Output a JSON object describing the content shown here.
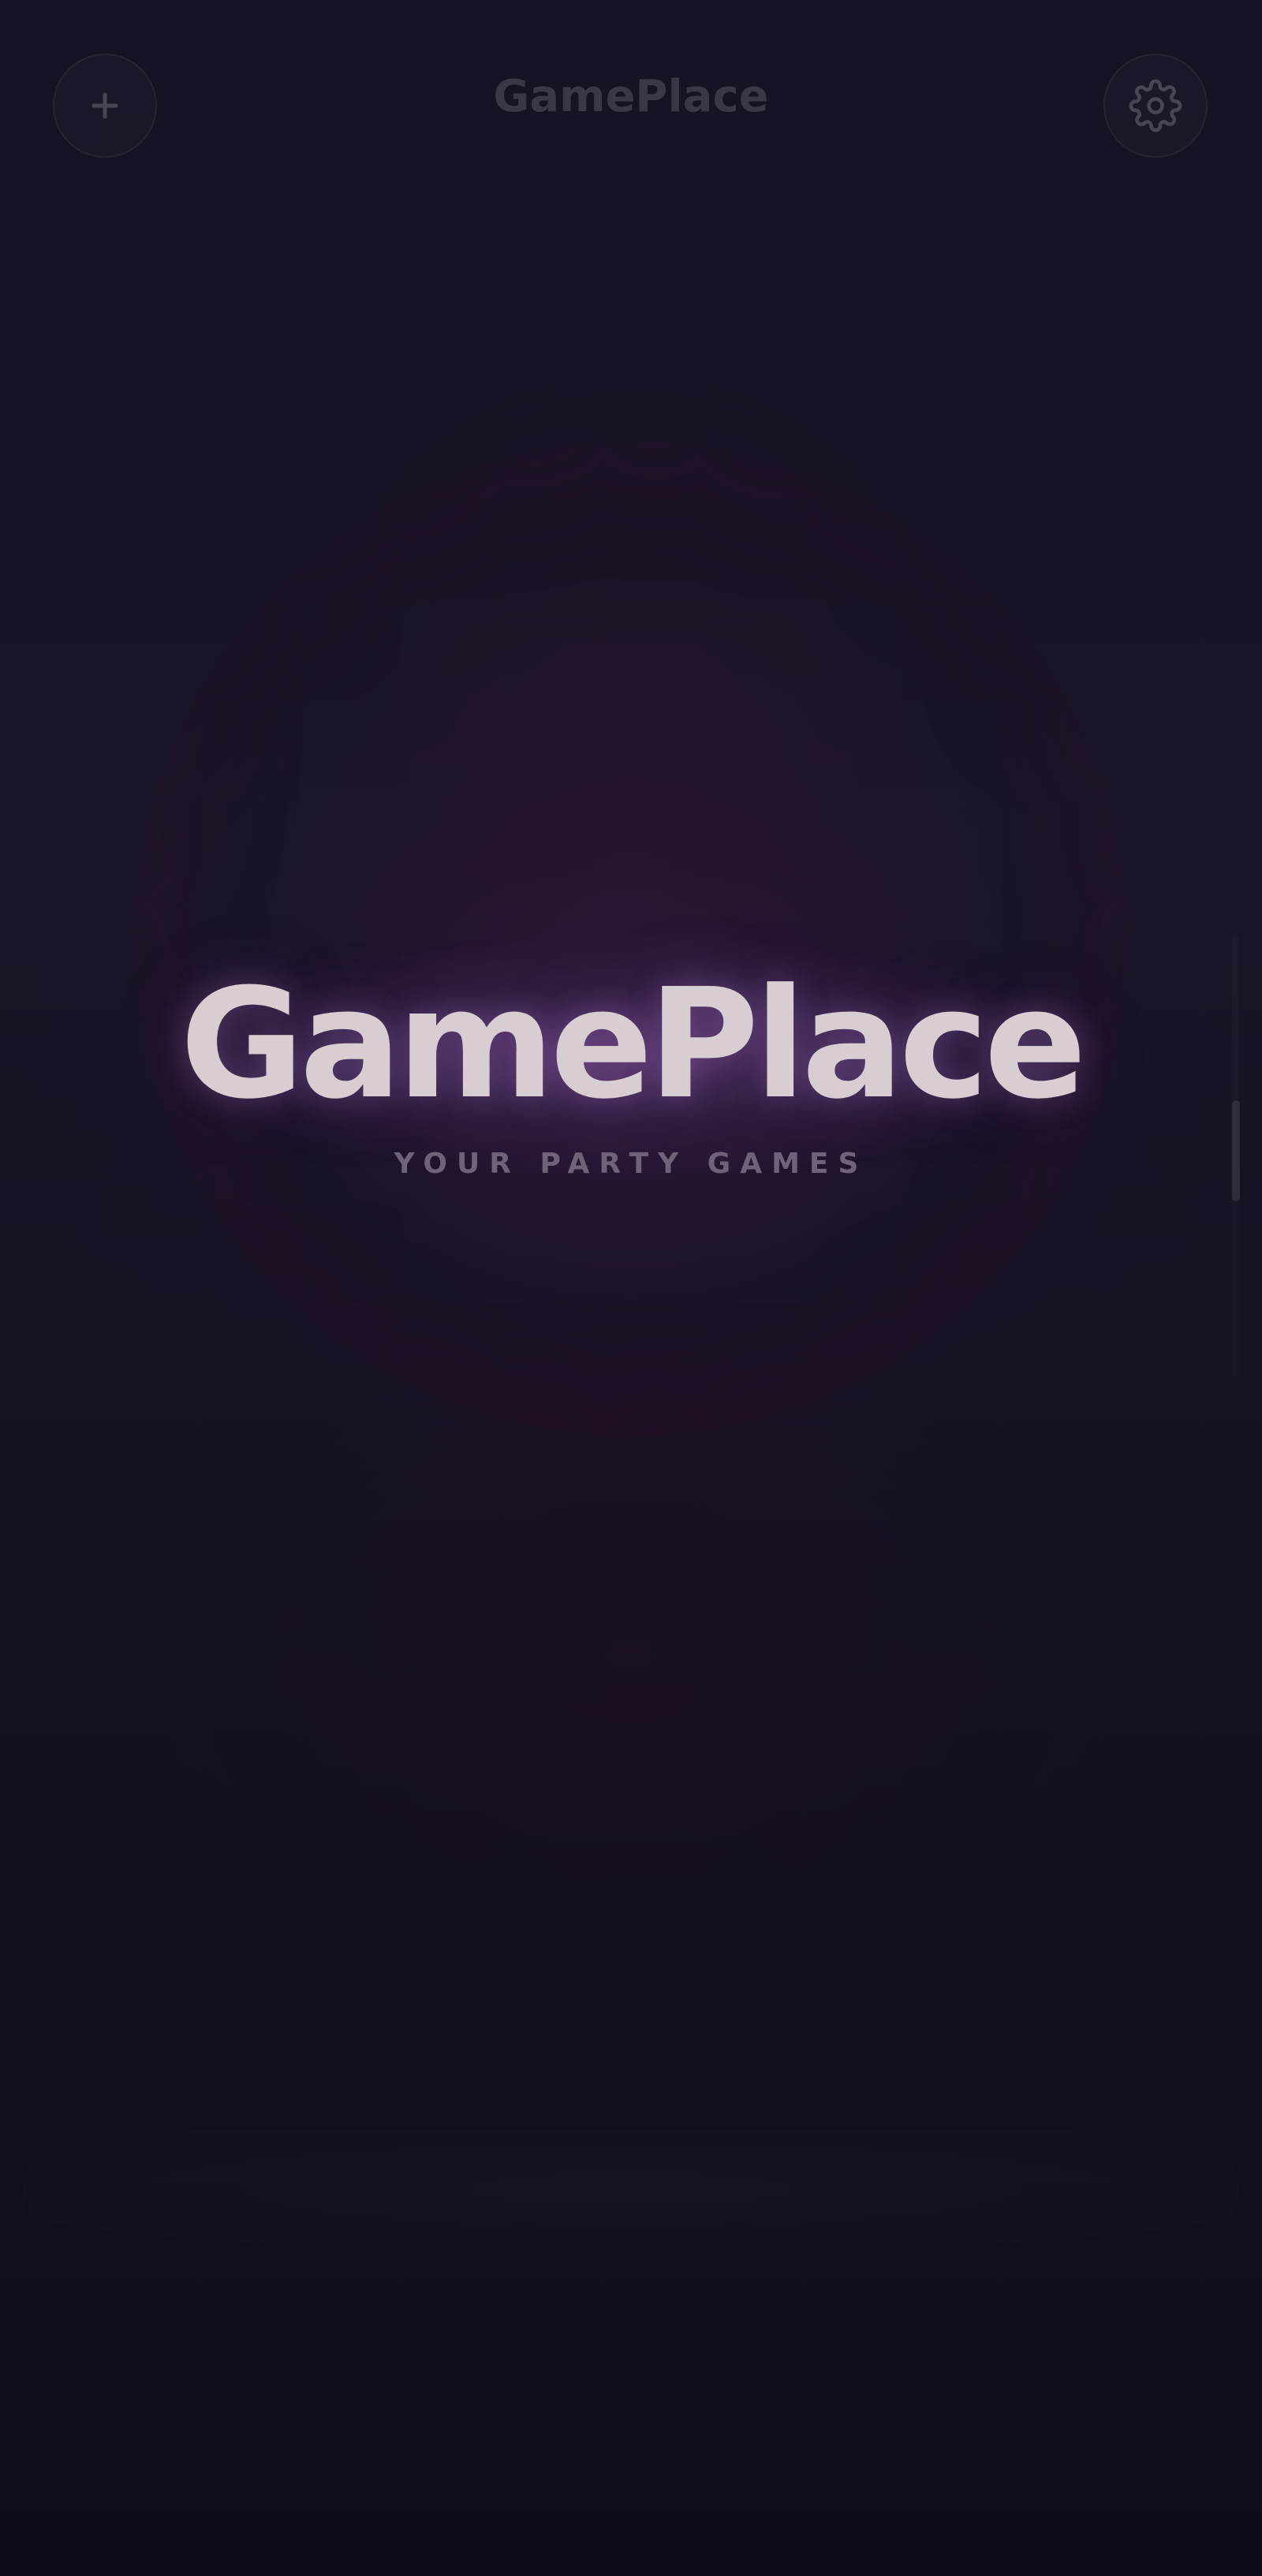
{
  "header": {
    "title": "GamePlace",
    "add_icon": "plus-icon",
    "settings_icon": "gear-icon"
  },
  "hero": {
    "title": "GamePlace",
    "subtitle": "YOUR PARTY GAMES"
  },
  "colors": {
    "background": "#161022",
    "hero_title": "#d8cdd2",
    "subtitle": "#6e6378",
    "header_title": "#3c3748",
    "glow": "#8c5aaa"
  }
}
